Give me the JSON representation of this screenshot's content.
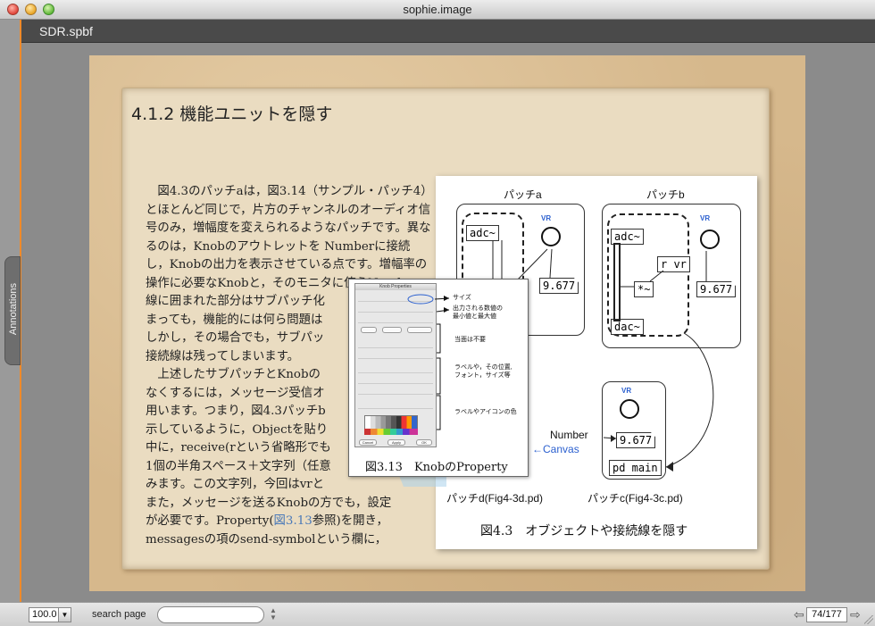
{
  "window": {
    "title": "sophie.image"
  },
  "document": {
    "name": "SDR.spbf"
  },
  "drawer": {
    "annotations_label": "Annotations"
  },
  "page": {
    "section_title": "4.1.2 機能ユニットを隠す",
    "paragraphs": [
      "図4.3のパッチaは，図3.14（サンプル・パッチ4）とほとんど同じで，片方のチャンネルのオーディオ信号のみ，増幅度を変えられるようなパッチです。異なるのは，Knobのアウトレットを Numberに接続し，Knobの出力を表示させている点です。増幅率の操作に必要なKnobと，そのモニタに使うNumber",
      "上述したサブパッチとKnobの",
      "用います。つまり，図4.3パッチb"
    ],
    "text_lines": [
      "線に囲まれた部分はサブパッチ化",
      "まっても，機能的には何ら問題は",
      "しかし，その場合でも，サブパッ",
      "接続線は残ってしまいます。",
      "なくするには，メッセージ受信オ",
      "示しているように，Objectを貼り",
      "中に，receive(rという省略形でも",
      "1個の半角スペース＋文字列（任意",
      "みます。この文字列，今回はvrと",
      "また，メッセージを送るKnobの方でも，設定",
      "が必要です。Property(",
      "図3.13",
      "参照)を開き，",
      "messagesの項のsend-symbolという欄に，"
    ],
    "figure": {
      "patch_a_title": "パッチa",
      "patch_b_title": "パッチb",
      "obj_adc": "adc~",
      "obj_dac": "dac~",
      "obj_star": "*~",
      "obj_rvr": "r vr",
      "obj_pdmain": "pd main",
      "vr_label": "VR",
      "number_value": "9.677",
      "number_label": "Number",
      "canvas_label": "Canvas",
      "patch_d_label": "パッチd(Fig4-3d.pd)",
      "patch_c_label": "パッチc(Fig4-3c.pd)",
      "caption": "図4.3　オブジェクトや接続線を隠す"
    },
    "props_figure": {
      "dialog_title": "Knob Properties",
      "dialog_ok": "OK",
      "dialog_apply": "Apply",
      "dialog_cancel": "Cancel",
      "ann_size": "サイズ",
      "ann_minmax": "出力される数値の\n最小値と最大値",
      "ann_unneeded": "当面は不要",
      "ann_label": "ラベルや，その位置,\nフォント，サイズ等",
      "ann_colors": "ラベルやアイコンの色",
      "caption": "図3.13　KnobのProperty"
    }
  },
  "bottombar": {
    "zoom_value": "100.0",
    "search_label": "search page",
    "search_placeholder": "",
    "page_indicator": "74/177"
  },
  "colors": {
    "accent_edge": "#f08a2a",
    "link": "#4a79b8",
    "vr": "#2a5fcf"
  }
}
